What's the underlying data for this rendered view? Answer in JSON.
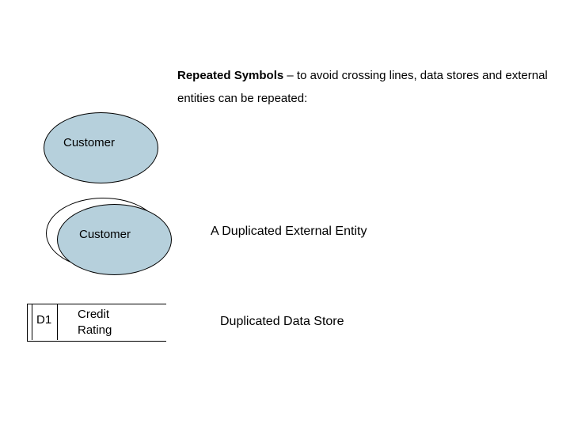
{
  "heading": {
    "bold": "Repeated Symbols",
    "rest": " – to avoid crossing lines, data stores and external entities can be repeated:"
  },
  "ellipse1_label": "Customer",
  "ellipse2_label": "Customer",
  "duplicated_entity_caption": "A Duplicated External Entity",
  "datastore": {
    "id": "D1",
    "name_line1": "Credit",
    "name_line2": "Rating"
  },
  "duplicated_datastore_caption": "Duplicated Data Store"
}
